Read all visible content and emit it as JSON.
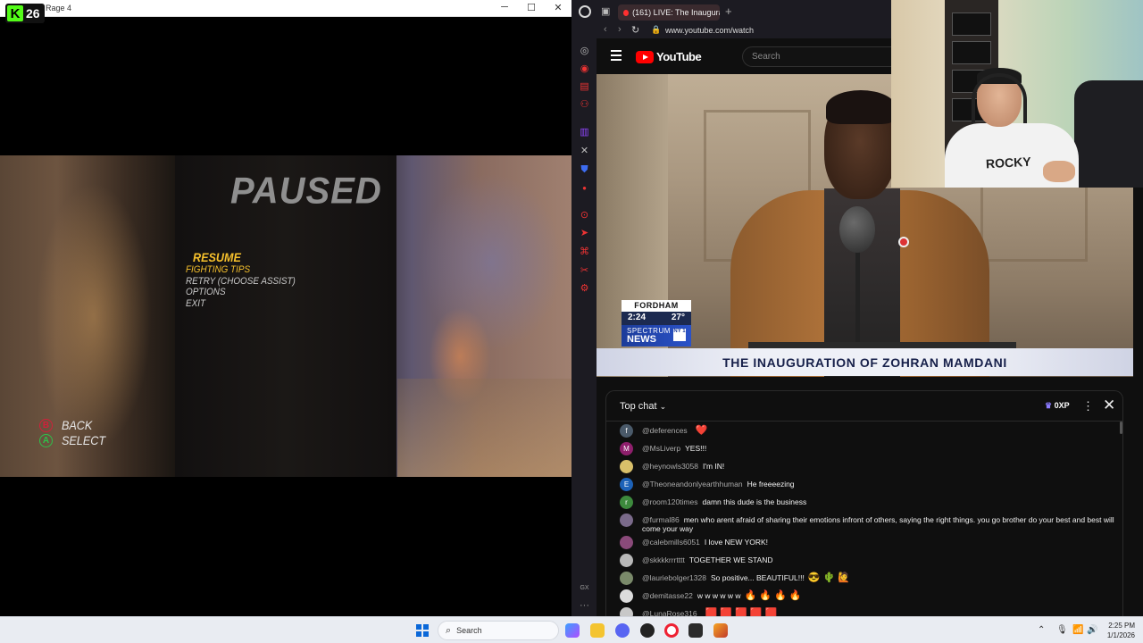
{
  "game": {
    "window_title": "Rage 4",
    "kick_number": "26",
    "kick_letter": "K",
    "paused_title": "PAUSED",
    "menu": [
      "RESUME",
      "FIGHTING TIPS",
      "RETRY (CHOOSE ASSIST)",
      "OPTIONS",
      "EXIT"
    ],
    "selected_index": 0,
    "hints": [
      {
        "button": "B",
        "label": "BACK",
        "color": "#d0203a"
      },
      {
        "button": "A",
        "label": "SELECT",
        "color": "#2fbf4a"
      }
    ]
  },
  "browser": {
    "tab_title": "(161) LIVE: The Inauguratio",
    "url": "www.youtube.com/watch",
    "youtube_logo_text": "YouTube",
    "search_placeholder": "Search"
  },
  "video": {
    "ticker_location": "FORDHAM",
    "ticker_time": "2:24",
    "ticker_temp": "27°",
    "ticker_brand_small": "SPECTRUM",
    "ticker_brand_big": "NEWS",
    "ticker_badge": "NY 1",
    "lower_third": "THE INAUGURATION OF ZOHRAN MAMDANI"
  },
  "webcam": {
    "shirt_text": "ROCKY"
  },
  "chat": {
    "title": "Top chat",
    "points_label": "0XP",
    "messages": [
      {
        "avatar": "f",
        "avatar_color": "#4a5a6a",
        "user": "@deferences",
        "text": "",
        "emoji": "❤️"
      },
      {
        "avatar": "M",
        "avatar_color": "#8e1f6c",
        "user": "@MsLiverp",
        "text": "YES!!!",
        "emoji": ""
      },
      {
        "avatar": "",
        "avatar_color": "#d8c06a",
        "user": "@heynowls3058",
        "text": "I'm IN!",
        "emoji": ""
      },
      {
        "avatar": "E",
        "avatar_color": "#1d62b8",
        "user": "@Theoneandonlyearthhuman",
        "text": "He freeeezing",
        "emoji": ""
      },
      {
        "avatar": "r",
        "avatar_color": "#3d8a3d",
        "user": "@room120times",
        "text": "damn this dude is the business",
        "emoji": ""
      },
      {
        "avatar": "",
        "avatar_color": "#7a6a8a",
        "user": "@furmal86",
        "text": "men who arent afraid of sharing their emotions infront of others, saying the right things. you go brother do your best and best will come your way",
        "emoji": ""
      },
      {
        "avatar": "",
        "avatar_color": "#8a4a7a",
        "user": "@calebmills6051",
        "text": "I love NEW YORK!",
        "emoji": ""
      },
      {
        "avatar": "",
        "avatar_color": "#b8b8b8",
        "user": "@skkkkrrrtttt",
        "text": "TOGETHER WE STAND",
        "emoji": ""
      },
      {
        "avatar": "",
        "avatar_color": "#7a8a6a",
        "user": "@lauriebolger1328",
        "text": "So positive... BEAUTIFUL!!!",
        "emoji": "😎 🌵 🙋"
      },
      {
        "avatar": "",
        "avatar_color": "#dcdcdc",
        "user": "@demitasse22",
        "text": "w w w w w w",
        "emoji": "🔥 🔥 🔥 🔥"
      },
      {
        "avatar": "",
        "avatar_color": "#c8c8c8",
        "user": "@LunaRose316",
        "text": "",
        "emoji": "🟥 🟥 🟥 🟥 🟥"
      }
    ]
  },
  "taskbar": {
    "search_label": "Search",
    "time": "2:25 PM",
    "date": "1/1/2026"
  }
}
